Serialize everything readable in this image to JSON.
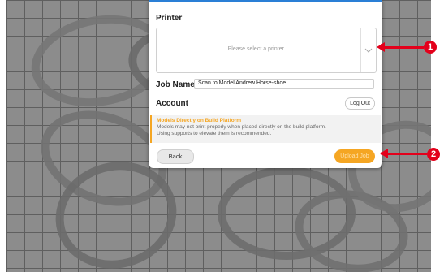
{
  "dialog": {
    "printer_heading": "Printer",
    "printer_placeholder": "Please select a printer...",
    "job_name_label": "Job Name",
    "job_name_value": "Scan to Model Andrew Horse-shoe",
    "account_label": "Account",
    "logout_label": "Log Out",
    "warning_title": "Models Directly on Build Platform",
    "warning_body_line1": "Models may not print properly when placed directly on the build platform.",
    "warning_body_line2": "Using supports to elevate them is recommended.",
    "back_label": "Back",
    "upload_label": "Upload Job"
  },
  "callouts": {
    "one": "1",
    "two": "2"
  },
  "icons": {
    "select_chevron": "chevron-down-icon"
  },
  "colors": {
    "accent": "#f5a623",
    "callout": "#e3001b",
    "topbar": "#2a7fd6"
  }
}
